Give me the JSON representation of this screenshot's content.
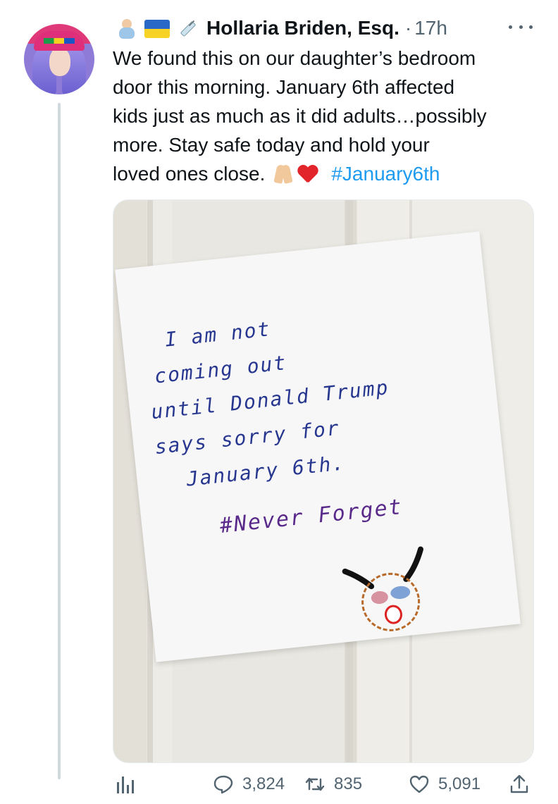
{
  "author": {
    "display_name": "Hollaria Briden, Esq.",
    "name_emojis": [
      "baby-icon",
      "ukraine-flag-icon",
      "syringe-icon"
    ],
    "separator": "·",
    "time": "17h"
  },
  "tweet": {
    "lines": [
      "We found this on our daughter’s bedroom",
      "door this morning.  January 6th affected",
      "kids just as much as it did adults…possibly",
      "more.  Stay safe today and hold your",
      "loved ones close."
    ],
    "hashtag": "#January6th"
  },
  "media": {
    "note_lines": [
      "I am not",
      "coming out",
      "until Donald Trump",
      "says sorry for",
      "January 6th."
    ],
    "note_hashtag": "#Never Forget"
  },
  "actions": {
    "replies": "3,824",
    "retweets": "835",
    "likes": "5,091"
  },
  "colors": {
    "text": "#0f1419",
    "secondary": "#536471",
    "link": "#1d9bf0",
    "thread_line": "#cfd9de"
  }
}
